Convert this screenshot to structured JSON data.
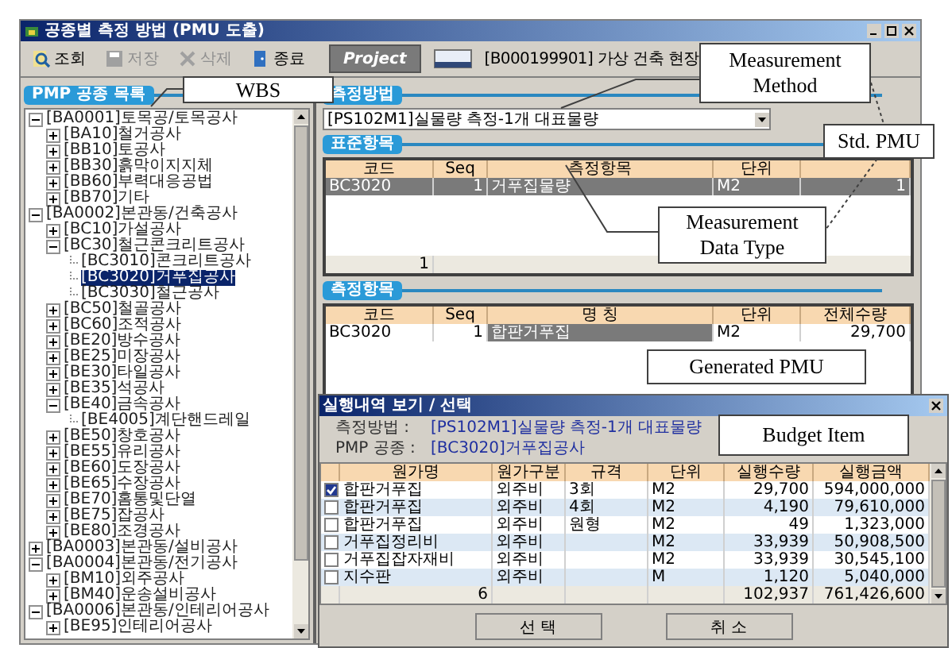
{
  "window": {
    "title": "공종별 측정 방법 (PMU 도출)"
  },
  "toolbar": {
    "buttons": [
      {
        "label": "조회",
        "disabled": false
      },
      {
        "label": "저장",
        "disabled": true
      },
      {
        "label": "삭제",
        "disabled": true
      },
      {
        "label": "종료",
        "disabled": false
      }
    ],
    "project_button": "Project",
    "project": "[B000199901] 가상 건축 현장"
  },
  "tree": {
    "title": "PMP 공종 목록",
    "items": [
      {
        "label": "[BA0001]토목공/토목공사",
        "expanded": true,
        "selected": false,
        "children": [
          {
            "label": "[BA10]철거공사",
            "expanded": false,
            "selected": false
          },
          {
            "label": "[BB10]토공사",
            "expanded": false,
            "selected": false
          },
          {
            "label": "[BB30]흙막이지지체",
            "expanded": false,
            "selected": false
          },
          {
            "label": "[BB60]부력대응공법",
            "expanded": false,
            "selected": false
          },
          {
            "label": "[BB70]기타",
            "expanded": false,
            "selected": false
          }
        ]
      },
      {
        "label": "[BA0002]본관동/건축공사",
        "expanded": true,
        "selected": false,
        "children": [
          {
            "label": "[BC10]가설공사",
            "expanded": false,
            "selected": false
          },
          {
            "label": "[BC30]철근콘크리트공사",
            "expanded": true,
            "selected": false,
            "children": [
              {
                "label": "[BC3010]콘크리트공사",
                "selected": false
              },
              {
                "label": "[BC3020]거푸집공사",
                "selected": true
              },
              {
                "label": "[BC3030]철근공사",
                "selected": false
              }
            ]
          },
          {
            "label": "[BC50]철골공사",
            "expanded": false,
            "selected": false
          },
          {
            "label": "[BC60]조적공사",
            "expanded": false,
            "selected": false
          },
          {
            "label": "[BE20]방수공사",
            "expanded": false,
            "selected": false
          },
          {
            "label": "[BE25]미장공사",
            "expanded": false,
            "selected": false
          },
          {
            "label": "[BE30]타일공사",
            "expanded": false,
            "selected": false
          },
          {
            "label": "[BE35]석공사",
            "expanded": false,
            "selected": false
          },
          {
            "label": "[BE40]금속공사",
            "expanded": true,
            "selected": false,
            "children": [
              {
                "label": "[BE4005]계단핸드레일",
                "selected": false
              }
            ]
          },
          {
            "label": "[BE50]창호공사",
            "expanded": false,
            "selected": false
          },
          {
            "label": "[BE55]유리공사",
            "expanded": false,
            "selected": false
          },
          {
            "label": "[BE60]도장공사",
            "expanded": false,
            "selected": false
          },
          {
            "label": "[BE65]수장공사",
            "expanded": false,
            "selected": false
          },
          {
            "label": "[BE70]홈통및단열",
            "expanded": false,
            "selected": false
          },
          {
            "label": "[BE75]잡공사",
            "expanded": false,
            "selected": false
          },
          {
            "label": "[BE80]조경공사",
            "expanded": false,
            "selected": false
          }
        ]
      },
      {
        "label": "[BA0003]본관동/설비공사",
        "expanded": false,
        "selected": false
      },
      {
        "label": "[BA0004]본관동/전기공사",
        "expanded": true,
        "selected": false,
        "children": [
          {
            "label": "[BM10]외주공사",
            "expanded": false,
            "selected": false
          },
          {
            "label": "[BM40]운송설비공사",
            "expanded": false,
            "selected": false
          }
        ]
      },
      {
        "label": "[BA0006]본관동/인테리어공사",
        "expanded": true,
        "selected": false,
        "children": [
          {
            "label": "[BE95]인테리어공사",
            "expanded": false,
            "selected": false
          }
        ]
      }
    ]
  },
  "measurement_method": {
    "label": "측정방법",
    "value": "[PS102M1]실물량 측정-1개 대표물량"
  },
  "standard_items": {
    "label": "표준항목",
    "columns": [
      "코드",
      "Seq",
      "측정항목",
      "단위"
    ],
    "rows": [
      {
        "cells": [
          "BC3020",
          "1",
          "거푸집물량",
          "M2",
          "1"
        ],
        "selected": true
      }
    ],
    "footer": "1"
  },
  "measurement_items": {
    "label": "측정항목",
    "columns": [
      "코드",
      "Seq",
      "명 칭",
      "단위",
      "전체수량"
    ],
    "rows": [
      {
        "cells": [
          {
            "text": "BC3020",
            "selected": false
          },
          {
            "text": "1",
            "selected": false
          },
          {
            "text": "합판거푸집",
            "selected": true
          },
          {
            "text": "M2",
            "selected": false
          },
          {
            "text": "29,700",
            "selected": false
          }
        ]
      }
    ]
  },
  "dialog": {
    "title": "실행내역 보기 / 선택",
    "fields": [
      {
        "label": "측정방법 :",
        "value": "[PS102M1]실물량 측정-1개 대표물량"
      },
      {
        "label": "PMP 공종 :",
        "value": "[BC3020]거푸집공사"
      }
    ],
    "columns": [
      "원가명",
      "원가구분",
      "규격",
      "단위",
      "실행수량",
      "실행금액"
    ],
    "rows": [
      {
        "checked": true,
        "cells": [
          "합판거푸집",
          "외주비",
          "3회",
          "M2",
          "29,700",
          "594,000,000"
        ]
      },
      {
        "checked": false,
        "cells": [
          "합판거푸집",
          "외주비",
          "4회",
          "M2",
          "4,190",
          "79,610,000"
        ]
      },
      {
        "checked": false,
        "cells": [
          "합판거푸집",
          "외주비",
          "원형",
          "M2",
          "49",
          "1,323,000"
        ]
      },
      {
        "checked": false,
        "cells": [
          "거푸집정리비",
          "외주비",
          "",
          "M2",
          "33,939",
          "50,908,500"
        ]
      },
      {
        "checked": false,
        "cells": [
          "거푸집잡자재비",
          "외주비",
          "",
          "M2",
          "33,939",
          "30,545,100"
        ]
      },
      {
        "checked": false,
        "cells": [
          "지수판",
          "외주비",
          "",
          "M",
          "1,120",
          "5,040,000"
        ]
      }
    ],
    "totals": {
      "count": "6",
      "quantity": "102,937",
      "amount": "761,426,600"
    },
    "buttons": [
      "선 택",
      "취 소"
    ]
  },
  "annotations": [
    {
      "text": "WBS"
    },
    {
      "text": "Measurement Method"
    },
    {
      "text": "Std. PMU"
    },
    {
      "text": "Measurement Data Type"
    },
    {
      "text": "Generated PMU"
    },
    {
      "text": "Budget Item"
    }
  ]
}
